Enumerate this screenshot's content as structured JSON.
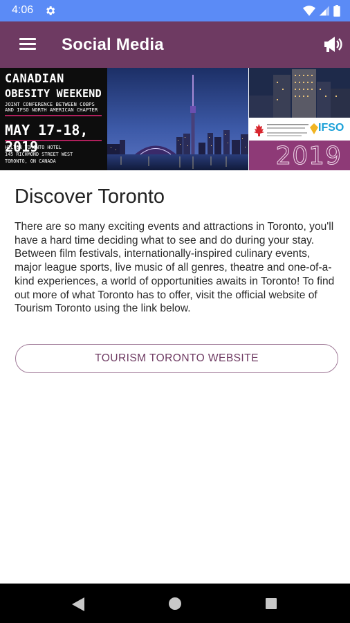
{
  "status_bar": {
    "time": "4:06",
    "icons": [
      "gear-icon",
      "wifi-icon",
      "signal-icon",
      "battery-icon"
    ]
  },
  "app_bar": {
    "title": "Social Media",
    "left_icon": "menu-icon",
    "right_icon": "megaphone-icon",
    "color": "#6e3a62"
  },
  "banner": {
    "line1": "CANADIAN",
    "line2": "OBESITY WEEKEND",
    "line3": "JOINT CONFERENCE BETWEEN COBPS AND IFSO NORTH AMERICAN CHAPTER",
    "dates": "MAY 17-18, 2019",
    "venue_line1": "HILTON TORONTO HOTEL",
    "venue_line2": "145 RICHMOND STREET WEST",
    "venue_line3": "TORONTO, ON CANADA",
    "logo_text": "IFSO",
    "year": "2019"
  },
  "content": {
    "heading": "Discover Toronto",
    "body": "There are so many exciting events and attractions in Toronto, you'll have a hard time deciding what to see and do during your stay. Between film festivals, internationally-inspired culinary events, major league sports, live music of all genres, theatre and one-of-a-kind experiences, a world of opportunities awaits in Toronto! To find out more of what Toronto has to offer, visit the official website of Tourism Toronto using the link below.",
    "button_label": "TOURISM TORONTO WEBSITE"
  },
  "nav_bar": {
    "icons": [
      "back-icon",
      "home-icon",
      "recents-icon"
    ]
  }
}
